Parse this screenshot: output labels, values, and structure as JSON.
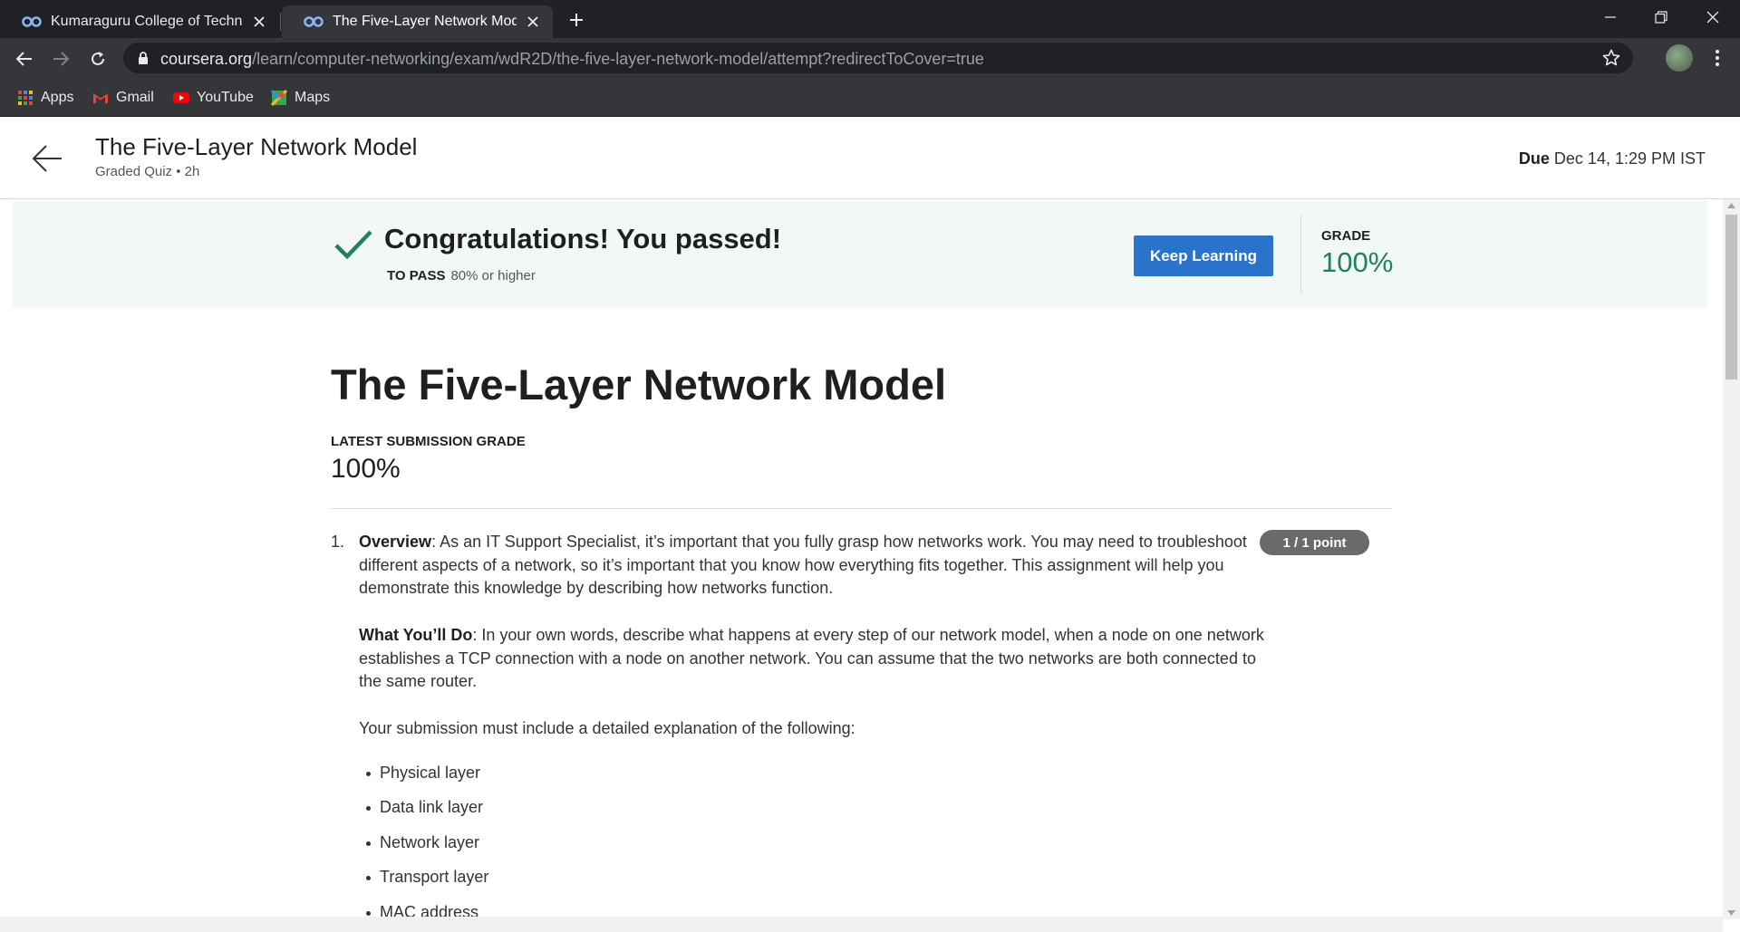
{
  "browser": {
    "tabs": [
      {
        "title": "Kumaraguru College of Technology",
        "active": false
      },
      {
        "title": "The Five-Layer Network Model | Coursera",
        "active": true
      }
    ],
    "url_host": "coursera.org",
    "url_path": "/learn/computer-networking/exam/wdR2D/the-five-layer-network-model/attempt?redirectToCover=true",
    "bookmarks": [
      {
        "label": "Apps",
        "icon": "apps-grid-icon"
      },
      {
        "label": "Gmail",
        "icon": "gmail-icon"
      },
      {
        "label": "YouTube",
        "icon": "youtube-icon"
      },
      {
        "label": "Maps",
        "icon": "maps-icon"
      }
    ]
  },
  "header": {
    "title": "The Five-Layer Network Model",
    "subtitle": "Graded Quiz • 2h",
    "due_label": "Due",
    "due_value": "Dec 14, 1:29 PM IST"
  },
  "banner": {
    "message": "Congratulations! You passed!",
    "to_pass_label": "TO PASS",
    "to_pass_value": "80% or higher",
    "button_label": "Keep Learning",
    "grade_label": "GRADE",
    "grade_value": "100%"
  },
  "main": {
    "title": "The Five-Layer Network Model",
    "latest_label": "LATEST SUBMISSION GRADE",
    "latest_value": "100%",
    "question": {
      "number": "1.",
      "points": "1 / 1 point",
      "overview_label": "Overview",
      "overview_text": ": As an IT Support Specialist, it’s important that you fully grasp how networks work. You may need to troubleshoot different aspects of a network, so it’s important that you know how everything fits together. This assignment will help you demonstrate this knowledge by describing how networks function.",
      "todo_label": "What You’ll Do",
      "todo_text": ": In your own words, describe what happens at every step of our network model, when a node on one network establishes a TCP connection with a node on another network. You can assume that the two networks are both connected to the same router.",
      "requirements_intro": "Your submission must include a detailed explanation of the following:",
      "requirements": [
        "Physical layer",
        "Data link layer",
        "Network layer",
        "Transport layer",
        "MAC address"
      ]
    }
  },
  "colors": {
    "brand_blue": "#2a73cc",
    "success_green": "#1f8354",
    "banner_bg": "#f1f8f6"
  }
}
